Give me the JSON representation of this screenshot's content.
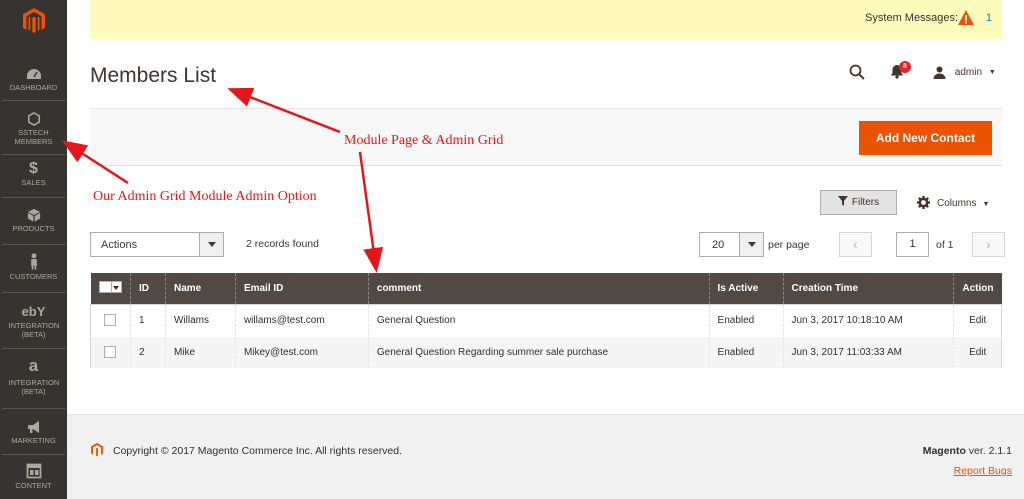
{
  "sidebar": {
    "items": [
      {
        "label": "DASHBOARD",
        "icon": "dashboard-icon"
      },
      {
        "label": "SSTECH MEMBERS",
        "icon": "hexagon-icon"
      },
      {
        "label": "SALES",
        "icon": "dollar-icon"
      },
      {
        "label": "PRODUCTS",
        "icon": "cube-icon"
      },
      {
        "label": "CUSTOMERS",
        "icon": "person-icon"
      },
      {
        "label": "INTEGRATION (BETA)",
        "icon": "ebay-icon"
      },
      {
        "label": "INTEGRATION (BETA)",
        "icon": "amazon-icon"
      },
      {
        "label": "MARKETING",
        "icon": "megaphone-icon"
      },
      {
        "label": "CONTENT",
        "icon": "content-icon"
      }
    ],
    "ebay_glyph": "ebY",
    "amazon_glyph": "a"
  },
  "system_messages": {
    "label": "System Messages:",
    "count": "1"
  },
  "header": {
    "title": "Members List",
    "notifications": "8",
    "user": "admin"
  },
  "toolbar": {
    "add_label": "Add New Contact",
    "filters_label": "Filters",
    "columns_label": "Columns",
    "actions_label": "Actions",
    "records_found": "2 records found",
    "per_page_value": "20",
    "per_page_label": "per page",
    "page_value": "1",
    "page_of": "of 1"
  },
  "grid": {
    "columns": [
      "ID",
      "Name",
      "Email ID",
      "comment",
      "Is Active",
      "Creation Time",
      "Action"
    ],
    "rows": [
      {
        "id": "1",
        "name": "Willams",
        "email": "willams@test.com",
        "comment": "General Question",
        "active": "Enabled",
        "created": "Jun 3, 2017 10:18:10 AM",
        "action": "Edit"
      },
      {
        "id": "2",
        "name": "Mike",
        "email": "Mikey@test.com",
        "comment": "General Question Regarding summer sale purchase",
        "active": "Enabled",
        "created": "Jun 3, 2017 11:03:33 AM",
        "action": "Edit"
      }
    ]
  },
  "footer": {
    "copyright": "Copyright © 2017 Magento Commerce Inc. All rights reserved.",
    "brand": "Magento",
    "version": "ver. 2.1.1",
    "report_bugs": "Report Bugs"
  },
  "annotations": {
    "module_page": "Module Page & Admin Grid",
    "admin_option": "Our Admin Grid Module Admin Option"
  },
  "colors": {
    "accent": "#eb5202",
    "sidebar": "#373330",
    "grid_header": "#514943",
    "annotation": "#e4161b"
  }
}
